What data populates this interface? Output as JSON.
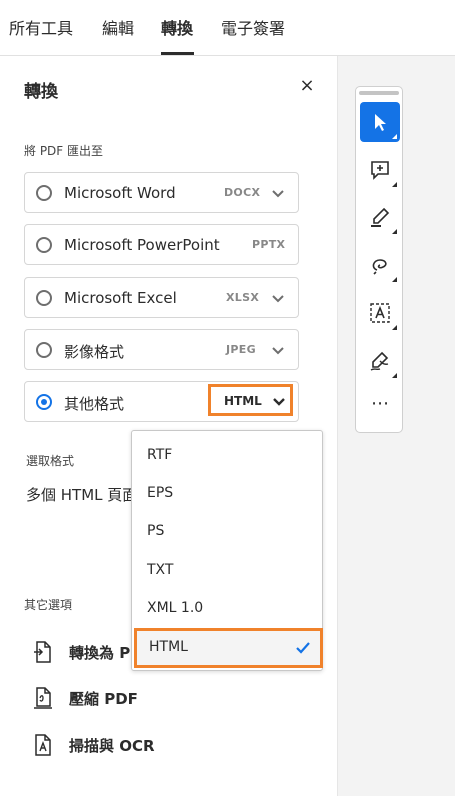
{
  "tabs": [
    "所有工具",
    "編輯",
    "轉換",
    "電子簽署"
  ],
  "panel": {
    "title": "轉換",
    "close": "×",
    "export_label": "將 PDF 匯出至",
    "options": [
      {
        "label": "Microsoft Word",
        "ext": "DOCX",
        "has_dropdown": true,
        "selected": false
      },
      {
        "label": "Microsoft PowerPoint",
        "ext": "PPTX",
        "has_dropdown": false,
        "selected": false
      },
      {
        "label": "Microsoft Excel",
        "ext": "XLSX",
        "has_dropdown": true,
        "selected": false
      },
      {
        "label": "影像格式",
        "ext": "JPEG",
        "has_dropdown": true,
        "selected": false
      },
      {
        "label": "其他格式",
        "ext": "HTML",
        "has_dropdown": true,
        "selected": true
      }
    ],
    "select_format_label": "選取格式",
    "select_format_value": "多個 HTML 頁面",
    "other_options_label": "其它選項",
    "actions": [
      "轉換為 PDF",
      "壓縮 PDF",
      "掃描與 OCR"
    ]
  },
  "menu": {
    "items": [
      "RTF",
      "EPS",
      "PS",
      "TXT",
      "XML 1.0",
      "HTML"
    ],
    "selected": "HTML"
  },
  "toolbar": {
    "tools": [
      "select-icon",
      "add-comment-icon",
      "highlight-icon",
      "freehand-draw-icon",
      "text-box-icon",
      "sign-icon"
    ],
    "more": "⋯",
    "active_color": "#1473e6"
  },
  "colors": {
    "accent": "#1473e6",
    "highlight": "#f0822b"
  }
}
